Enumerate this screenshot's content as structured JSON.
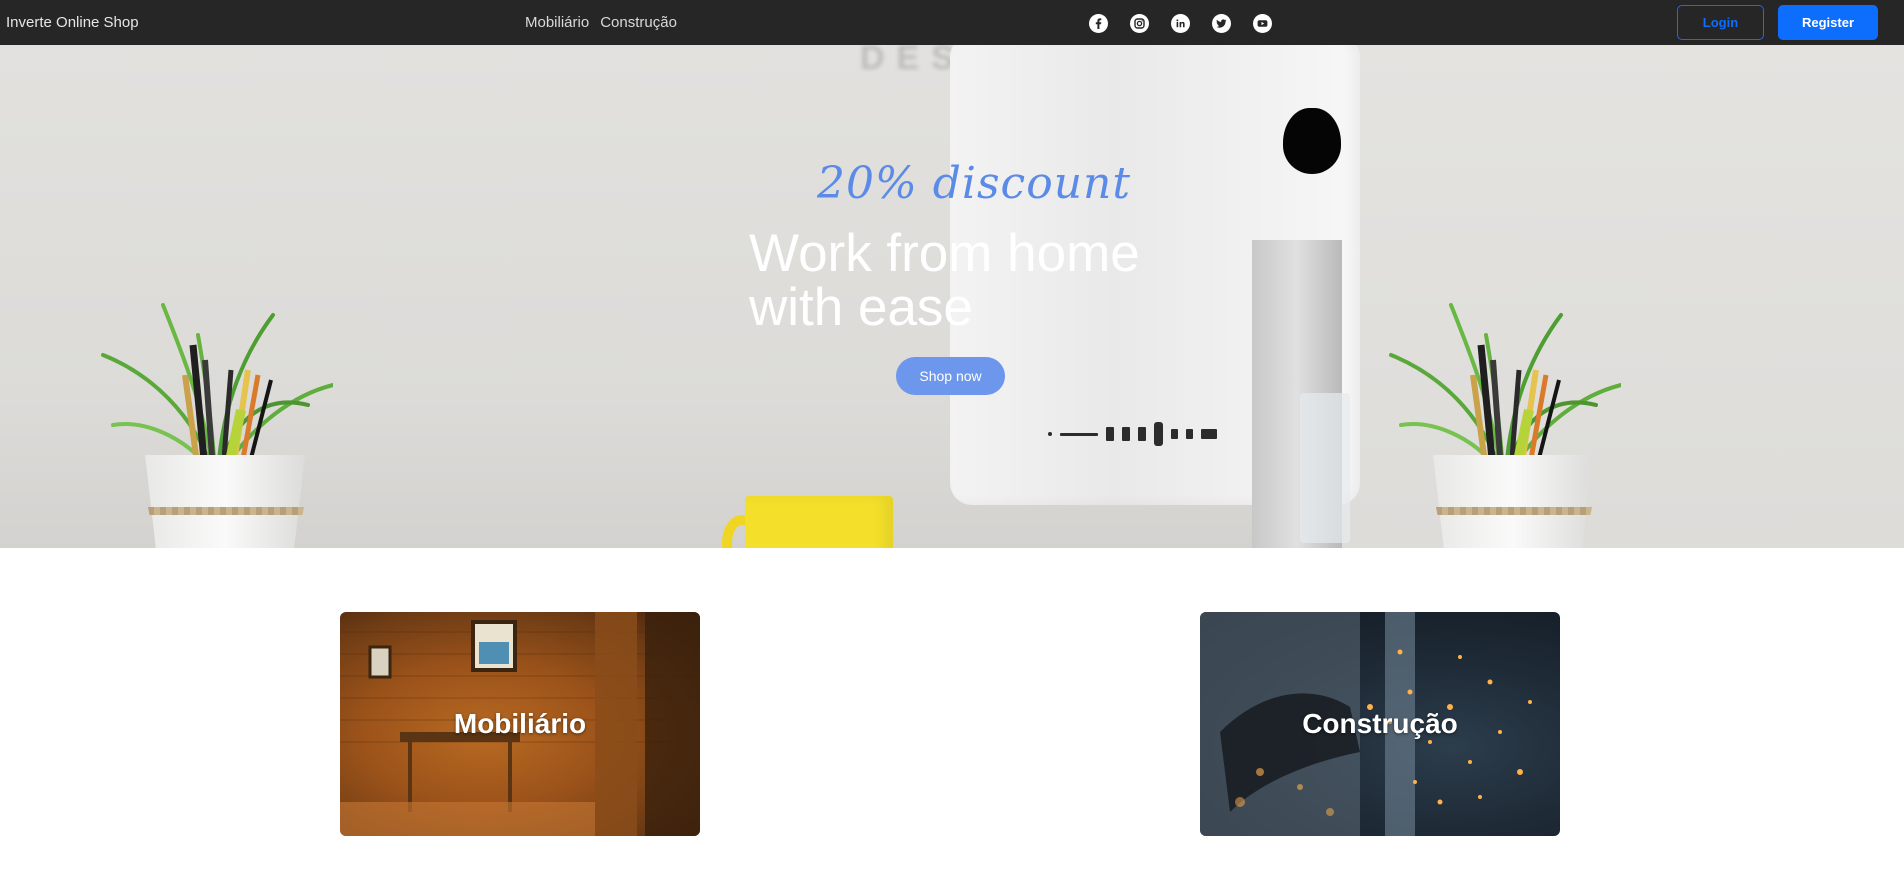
{
  "navbar": {
    "brand": "Inverte Online Shop",
    "links": [
      "Mobiliário",
      "Construção"
    ],
    "socials": [
      "facebook-icon",
      "instagram-icon",
      "linkedin-icon",
      "twitter-icon",
      "youtube-icon"
    ],
    "login_label": "Login",
    "register_label": "Register"
  },
  "hero": {
    "discount": "20% discount",
    "headline_line1": "Work from home",
    "headline_line2": "with ease",
    "cta_label": "Shop now"
  },
  "categories": [
    {
      "label": "Mobiliário"
    },
    {
      "label": "Construção"
    }
  ],
  "colors": {
    "navbar_bg": "#262626",
    "primary": "#0d6efd",
    "hero_accent": "#5b8be6",
    "cta_bg": "#6c97ec"
  }
}
